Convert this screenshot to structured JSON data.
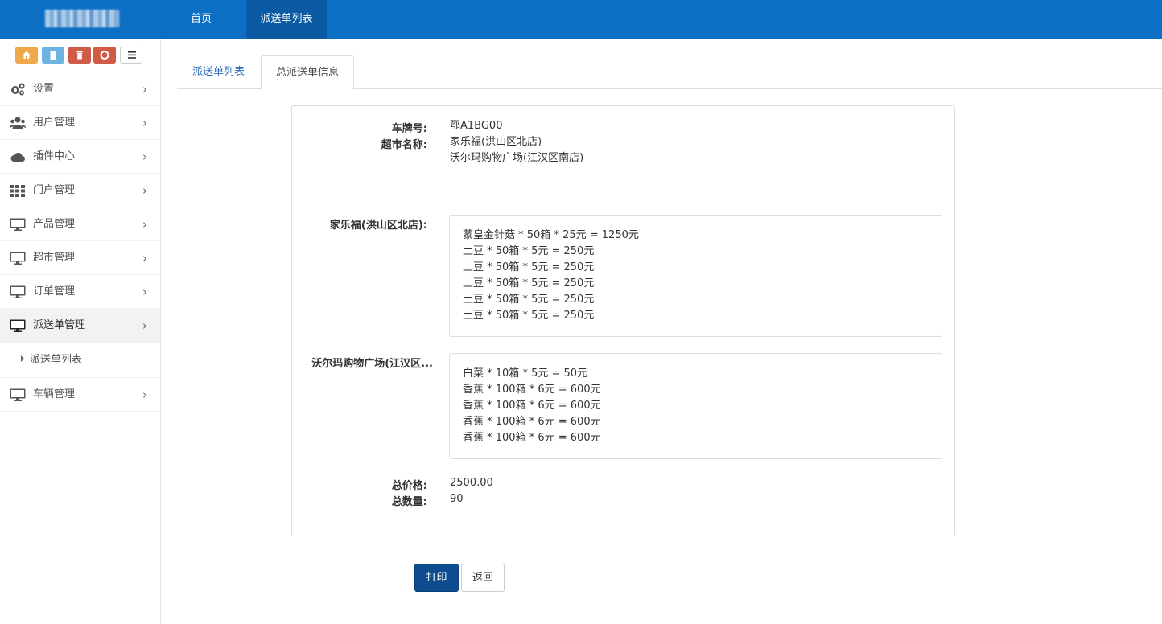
{
  "topnav": {
    "home": "首页",
    "dispatch_list": "派送单列表"
  },
  "shortcuts": [
    "home-icon",
    "file-icon",
    "trash-icon",
    "recycle-icon",
    "list-icon"
  ],
  "sidebar": {
    "items": [
      {
        "label": "设置",
        "icon": "gears-icon"
      },
      {
        "label": "用户管理",
        "icon": "users-icon"
      },
      {
        "label": "插件中心",
        "icon": "cloud-icon"
      },
      {
        "label": "门户管理",
        "icon": "grid-icon"
      },
      {
        "label": "产品管理",
        "icon": "monitor-icon"
      },
      {
        "label": "超市管理",
        "icon": "monitor-icon"
      },
      {
        "label": "订单管理",
        "icon": "monitor-icon"
      },
      {
        "label": "派送单管理",
        "icon": "monitor-icon",
        "active": true
      },
      {
        "label": "车辆管理",
        "icon": "monitor-icon"
      }
    ],
    "subitem": "派送单列表"
  },
  "tabs": {
    "list": "派送单列表",
    "info": "总派送单信息"
  },
  "info": {
    "plate_label": "车牌号:",
    "plate_value": "鄂A1BG00",
    "supermarket_label": "超市名称:",
    "supermarkets": [
      "家乐福(洪山区北店)",
      "沃尔玛购物广场(江汉区南店)"
    ],
    "groups": [
      {
        "label": "家乐福(洪山区北店):",
        "lines": [
          "蒙皇金针菇 * 50箱 * 25元 = 1250元",
          "土豆 * 50箱 * 5元 = 250元",
          "土豆 * 50箱 * 5元 = 250元",
          "土豆 * 50箱 * 5元 = 250元",
          "土豆 * 50箱 * 5元 = 250元",
          "土豆 * 50箱 * 5元 = 250元"
        ]
      },
      {
        "label": "沃尔玛购物广场(江汉区...",
        "lines": [
          "白菜 * 10箱 * 5元 = 50元",
          "香蕉 * 100箱 * 6元 = 600元",
          "香蕉 * 100箱 * 6元 = 600元",
          "香蕉 * 100箱 * 6元 = 600元",
          "香蕉 * 100箱 * 6元 = 600元"
        ]
      }
    ],
    "total_price_label": "总价格:",
    "total_price": "2500.00",
    "total_qty_label": "总数量:",
    "total_qty": "90"
  },
  "buttons": {
    "print": "打印",
    "back": "返回"
  }
}
